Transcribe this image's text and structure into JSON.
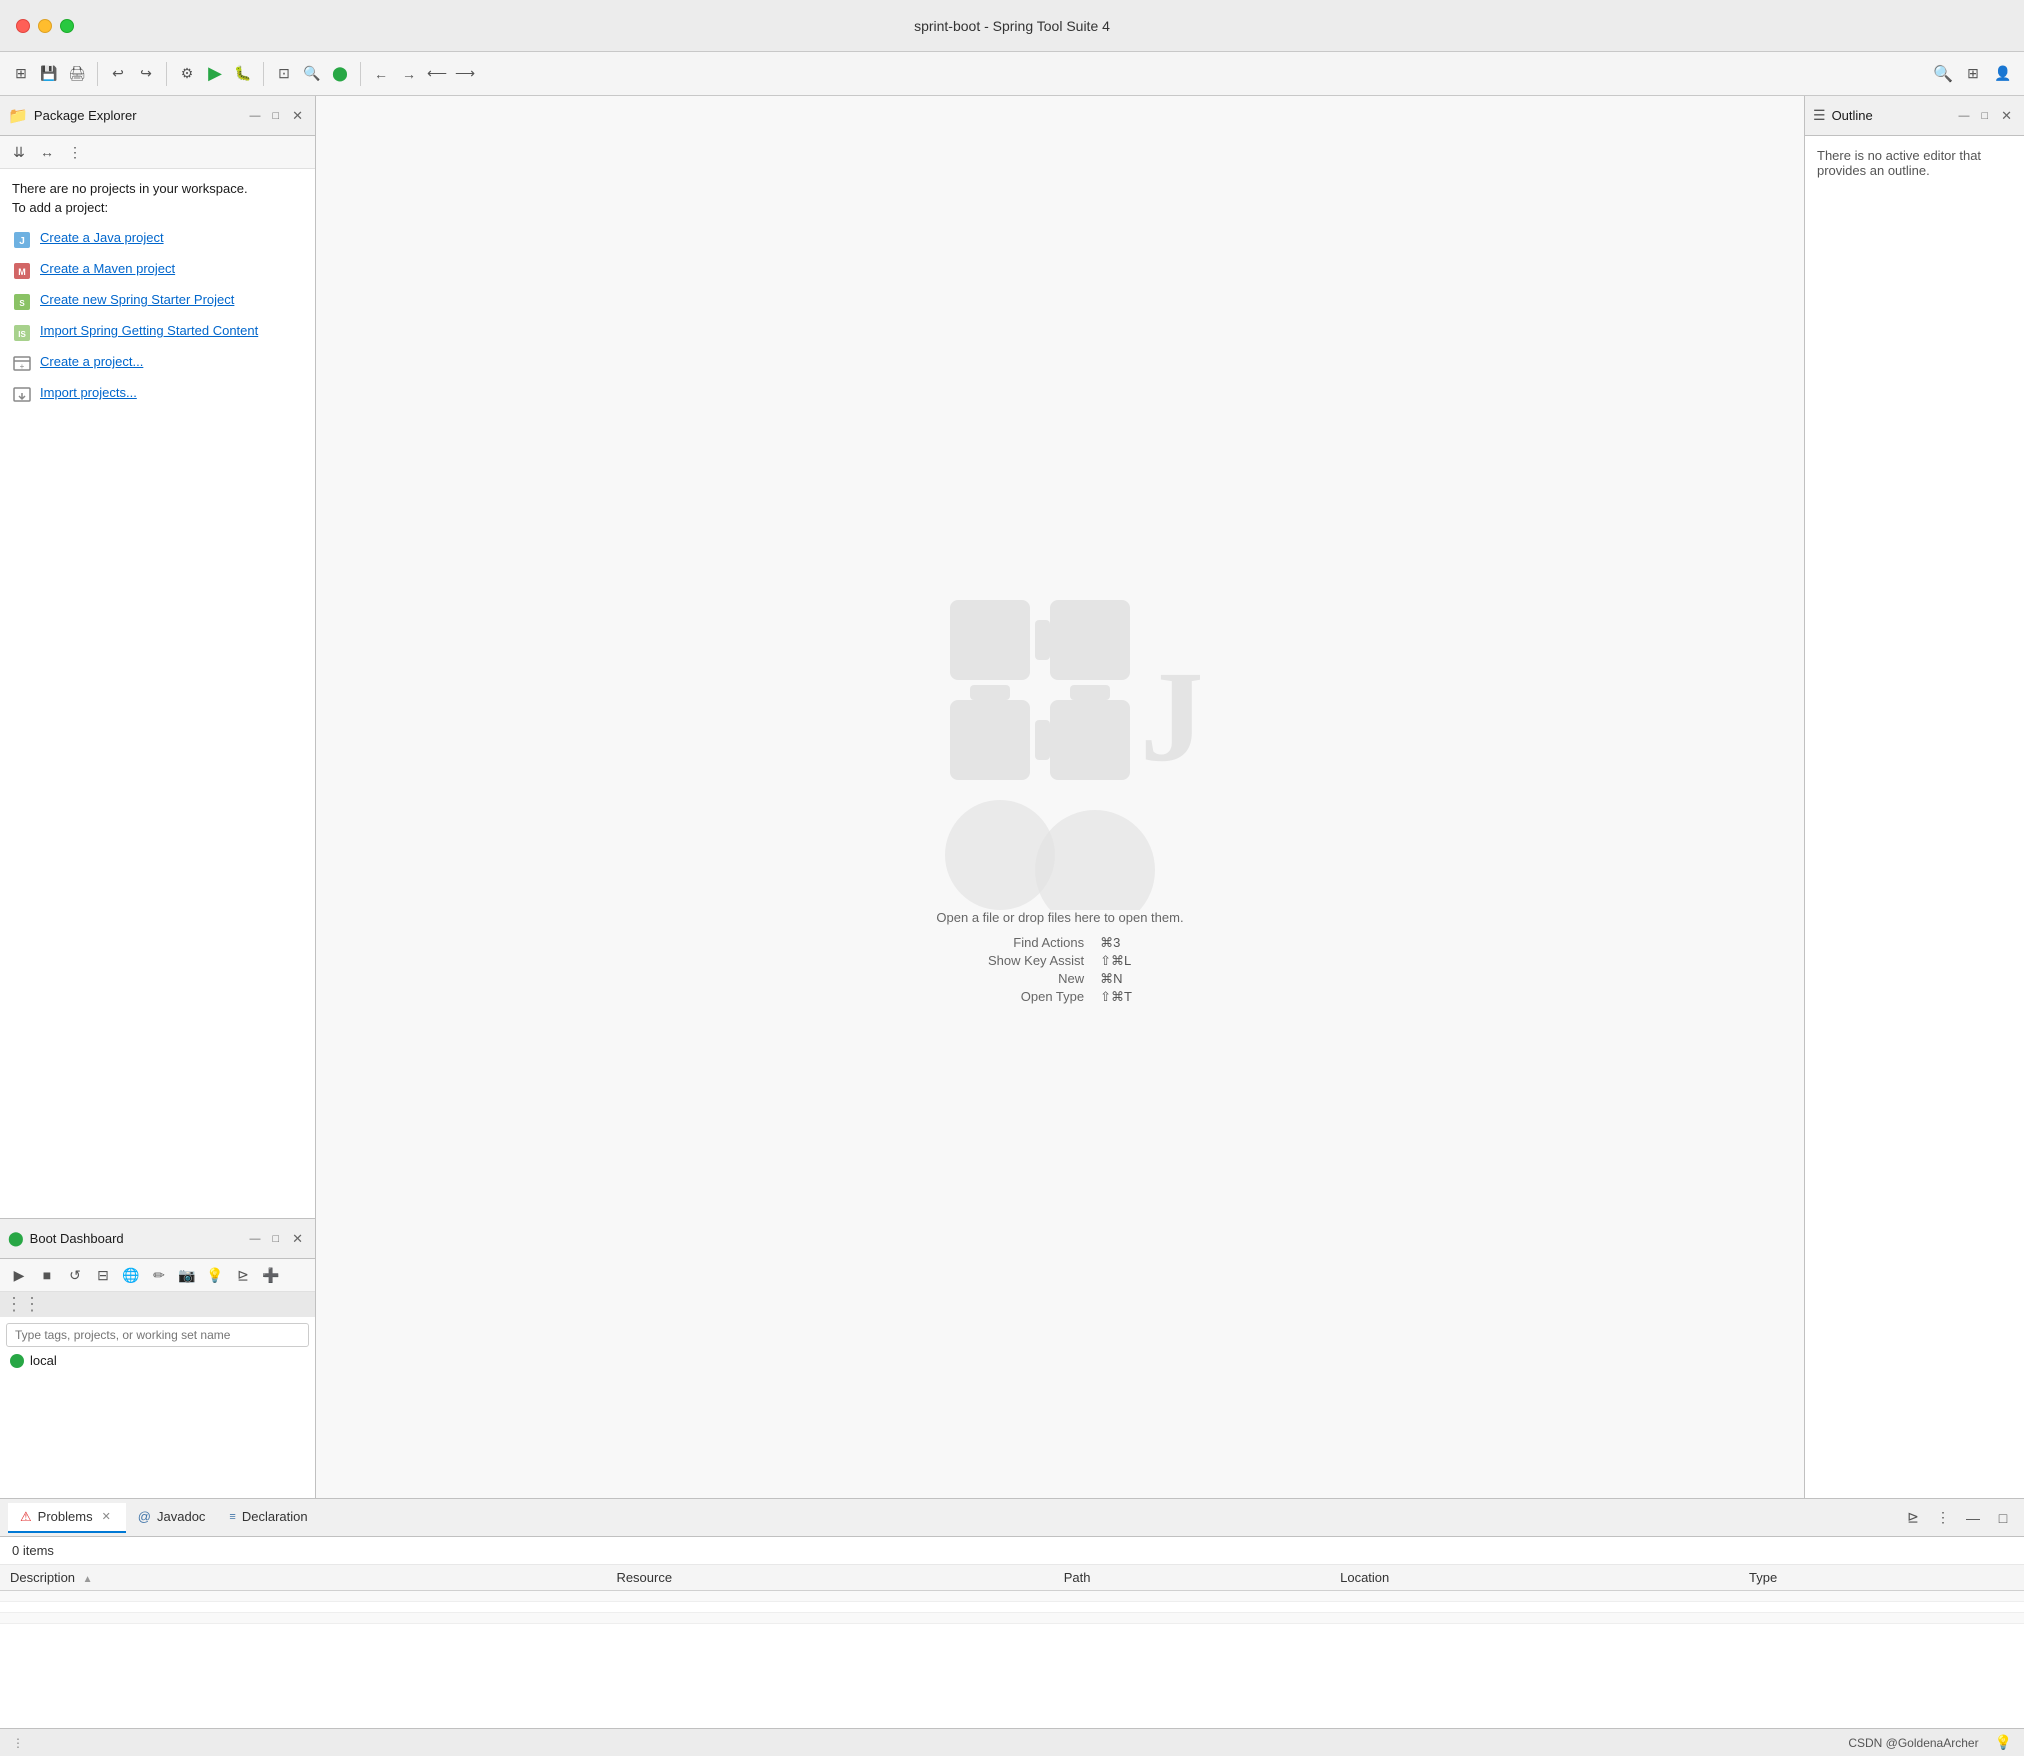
{
  "window": {
    "title": "sprint-boot - Spring Tool Suite 4"
  },
  "toolbar": {
    "run_label": "▶",
    "search_label": "🔍"
  },
  "package_explorer": {
    "title": "Package Explorer",
    "no_projects_line1": "There are no projects in your workspace.",
    "no_projects_line2": "To add a project:",
    "links": [
      {
        "id": "create-java",
        "label": "Create a Java project"
      },
      {
        "id": "create-maven",
        "label": "Create a Maven project"
      },
      {
        "id": "create-spring",
        "label": "Create new Spring Starter Project"
      },
      {
        "id": "import-spring",
        "label": "Import Spring Getting Started Content"
      },
      {
        "id": "create-project",
        "label": "Create a project..."
      },
      {
        "id": "import-projects",
        "label": "Import projects..."
      }
    ]
  },
  "boot_dashboard": {
    "title": "Boot Dashboard",
    "search_placeholder": "Type tags, projects, or working set name",
    "local_label": "local"
  },
  "editor": {
    "drop_hint": "Open a file or drop files here to open them.",
    "shortcuts": [
      {
        "label": "Find Actions",
        "key": "⌘3"
      },
      {
        "label": "Show Key Assist",
        "key": "⇧⌘L"
      },
      {
        "label": "New",
        "key": "⌘N"
      },
      {
        "label": "Open Type",
        "key": "⇧⌘T"
      }
    ]
  },
  "outline": {
    "title": "Outline",
    "no_outline_text": "There is no active editor that provides an outline."
  },
  "bottom_panel": {
    "tabs": [
      {
        "id": "problems",
        "label": "Problems",
        "closeable": true,
        "active": true
      },
      {
        "id": "javadoc",
        "label": "Javadoc",
        "closeable": false,
        "active": false
      },
      {
        "id": "declaration",
        "label": "Declaration",
        "closeable": false,
        "active": false
      }
    ],
    "items_count": "0 items",
    "table_headers": [
      "Description",
      "Resource",
      "Path",
      "Location",
      "Type"
    ],
    "rows": []
  },
  "status_bar": {
    "user": "CSDN @GoldenaArcher",
    "hint_icon": "💡"
  }
}
